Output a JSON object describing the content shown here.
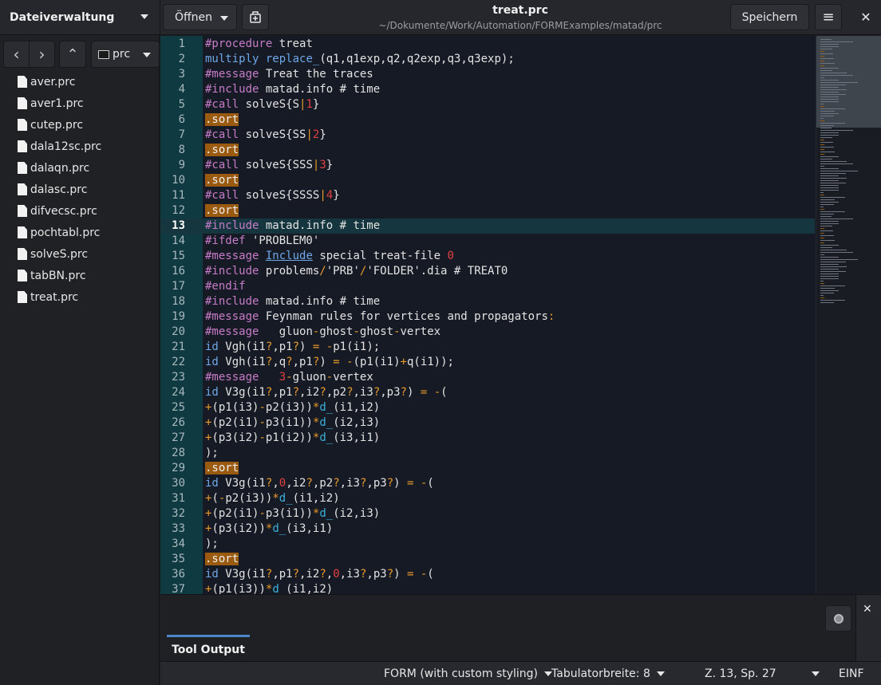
{
  "side_panel": {
    "title": "Dateiverwaltung"
  },
  "header": {
    "open_label": "Öffnen",
    "save_label": "Speichern",
    "title": "treat.prc",
    "path": "~/Dokumente/Work/Automation/FORMExamples/matad/prc",
    "close_glyph": "✕",
    "menu_glyph": "≡"
  },
  "file_browser": {
    "back_glyph": "‹",
    "forward_glyph": "›",
    "up_glyph": "⌃",
    "current_folder": "prc",
    "files": [
      "aver.prc",
      "aver1.prc",
      "cutep.prc",
      "dala12sc.prc",
      "dalaqn.prc",
      "dalasc.prc",
      "difvecsc.prc",
      "pochtabl.prc",
      "solveS.prc",
      "tabBN.prc",
      "treat.prc"
    ]
  },
  "editor": {
    "current_line": 13,
    "line_numbers": [
      "1",
      "2",
      "3",
      "4",
      "5",
      "6",
      "7",
      "8",
      "9",
      "10",
      "11",
      "12",
      "13",
      "14",
      "15",
      "16",
      "17",
      "18",
      "19",
      "20",
      "21",
      "22",
      "23",
      "24",
      "25",
      "26",
      "27",
      "28",
      "29",
      "30",
      "31",
      "32",
      "33",
      "34",
      "35",
      "36",
      "37"
    ],
    "lines": [
      [
        [
          "k",
          "#procedure"
        ],
        [
          "t",
          " treat"
        ]
      ],
      [
        [
          "b",
          "multiply"
        ],
        [
          "t",
          " "
        ],
        [
          "b",
          "replace_"
        ],
        [
          "t",
          "(q1,q1exp,q2,q2exp,q3,q3exp);"
        ]
      ],
      [
        [
          "k",
          "#message"
        ],
        [
          "t",
          " Treat the traces"
        ]
      ],
      [
        [
          "k",
          "#include"
        ],
        [
          "t",
          " matad.info # time"
        ]
      ],
      [
        [
          "k",
          "#call"
        ],
        [
          "t",
          " solveS{S"
        ],
        [
          "o",
          "|"
        ],
        [
          "r",
          "1"
        ],
        [
          "t",
          "}"
        ]
      ],
      [
        [
          "st",
          ".sort"
        ]
      ],
      [
        [
          "k",
          "#call"
        ],
        [
          "t",
          " solveS{SS"
        ],
        [
          "o",
          "|"
        ],
        [
          "r",
          "2"
        ],
        [
          "t",
          "}"
        ]
      ],
      [
        [
          "st",
          ".sort"
        ]
      ],
      [
        [
          "k",
          "#call"
        ],
        [
          "t",
          " solveS{SSS"
        ],
        [
          "o",
          "|"
        ],
        [
          "r",
          "3"
        ],
        [
          "t",
          "}"
        ]
      ],
      [
        [
          "st",
          ".sort"
        ]
      ],
      [
        [
          "k",
          "#call"
        ],
        [
          "t",
          " solveS{SSSS"
        ],
        [
          "o",
          "|"
        ],
        [
          "r",
          "4"
        ],
        [
          "t",
          "}"
        ]
      ],
      [
        [
          "st",
          ".sort"
        ]
      ],
      [
        [
          "k",
          "#include"
        ],
        [
          "t",
          " matad.info # time"
        ]
      ],
      [
        [
          "k",
          "#ifdef"
        ],
        [
          "t",
          " 'PROBLEM0'"
        ]
      ],
      [
        [
          "k",
          "#message"
        ],
        [
          "t",
          " "
        ],
        [
          "u",
          "Include"
        ],
        [
          "t",
          " special treat-file "
        ],
        [
          "r",
          "0"
        ]
      ],
      [
        [
          "k",
          "#include"
        ],
        [
          "t",
          " problems"
        ],
        [
          "o",
          "/"
        ],
        [
          "t",
          "'PRB'"
        ],
        [
          "o",
          "/"
        ],
        [
          "t",
          "'FOLDER'.dia # TREAT0"
        ]
      ],
      [
        [
          "k",
          "#endif"
        ]
      ],
      [
        [
          "k",
          "#include"
        ],
        [
          "t",
          " matad.info # time"
        ]
      ],
      [
        [
          "k",
          "#message"
        ],
        [
          "t",
          " Feynman rules for vertices and propagators"
        ],
        [
          "o",
          ":"
        ]
      ],
      [
        [
          "k",
          "#message"
        ],
        [
          "t",
          "   gluon"
        ],
        [
          "o",
          "-"
        ],
        [
          "t",
          "ghost"
        ],
        [
          "o",
          "-"
        ],
        [
          "t",
          "ghost"
        ],
        [
          "o",
          "-"
        ],
        [
          "t",
          "vertex"
        ]
      ],
      [
        [
          "b",
          "id"
        ],
        [
          "t",
          " Vgh(i1"
        ],
        [
          "o",
          "?"
        ],
        [
          "t",
          ",p1"
        ],
        [
          "o",
          "?"
        ],
        [
          "t",
          ") "
        ],
        [
          "o",
          "="
        ],
        [
          "t",
          " "
        ],
        [
          "o",
          "-"
        ],
        [
          "t",
          "p1(i1);"
        ]
      ],
      [
        [
          "b",
          "id"
        ],
        [
          "t",
          " Vgh(i1"
        ],
        [
          "o",
          "?"
        ],
        [
          "t",
          ",q"
        ],
        [
          "o",
          "?"
        ],
        [
          "t",
          ",p1"
        ],
        [
          "o",
          "?"
        ],
        [
          "t",
          ") "
        ],
        [
          "o",
          "="
        ],
        [
          "t",
          " "
        ],
        [
          "o",
          "-"
        ],
        [
          "t",
          "(p1(i1)"
        ],
        [
          "o",
          "+"
        ],
        [
          "t",
          "q(i1));"
        ]
      ],
      [
        [
          "k",
          "#message"
        ],
        [
          "t",
          "   "
        ],
        [
          "r",
          "3"
        ],
        [
          "o",
          "-"
        ],
        [
          "t",
          "gluon"
        ],
        [
          "o",
          "-"
        ],
        [
          "t",
          "vertex"
        ]
      ],
      [
        [
          "b",
          "id"
        ],
        [
          "t",
          " V3g(i1"
        ],
        [
          "o",
          "?"
        ],
        [
          "t",
          ",p1"
        ],
        [
          "o",
          "?"
        ],
        [
          "t",
          ",i2"
        ],
        [
          "o",
          "?"
        ],
        [
          "t",
          ",p2"
        ],
        [
          "o",
          "?"
        ],
        [
          "t",
          ",i3"
        ],
        [
          "o",
          "?"
        ],
        [
          "t",
          ",p3"
        ],
        [
          "o",
          "?"
        ],
        [
          "t",
          ") "
        ],
        [
          "o",
          "="
        ],
        [
          "t",
          " "
        ],
        [
          "o",
          "-"
        ],
        [
          "t",
          "("
        ]
      ],
      [
        [
          "o",
          "+"
        ],
        [
          "t",
          "(p1(i3)"
        ],
        [
          "o",
          "-"
        ],
        [
          "t",
          "p2(i3))"
        ],
        [
          "o",
          "*"
        ],
        [
          "c",
          "d_"
        ],
        [
          "t",
          "(i1,i2)"
        ]
      ],
      [
        [
          "o",
          "+"
        ],
        [
          "t",
          "(p2(i1)"
        ],
        [
          "o",
          "-"
        ],
        [
          "t",
          "p3(i1))"
        ],
        [
          "o",
          "*"
        ],
        [
          "c",
          "d_"
        ],
        [
          "t",
          "(i2,i3)"
        ]
      ],
      [
        [
          "o",
          "+"
        ],
        [
          "t",
          "(p3(i2)"
        ],
        [
          "o",
          "-"
        ],
        [
          "t",
          "p1(i2))"
        ],
        [
          "o",
          "*"
        ],
        [
          "c",
          "d_"
        ],
        [
          "t",
          "(i3,i1)"
        ]
      ],
      [
        [
          "t",
          ");"
        ]
      ],
      [
        [
          "st",
          ".sort"
        ]
      ],
      [
        [
          "b",
          "id"
        ],
        [
          "t",
          " V3g(i1"
        ],
        [
          "o",
          "?"
        ],
        [
          "t",
          ","
        ],
        [
          "r",
          "0"
        ],
        [
          "t",
          ",i2"
        ],
        [
          "o",
          "?"
        ],
        [
          "t",
          ",p2"
        ],
        [
          "o",
          "?"
        ],
        [
          "t",
          ",i3"
        ],
        [
          "o",
          "?"
        ],
        [
          "t",
          ",p3"
        ],
        [
          "o",
          "?"
        ],
        [
          "t",
          ") "
        ],
        [
          "o",
          "="
        ],
        [
          "t",
          " "
        ],
        [
          "o",
          "-"
        ],
        [
          "t",
          "("
        ]
      ],
      [
        [
          "o",
          "+"
        ],
        [
          "t",
          "("
        ],
        [
          "o",
          "-"
        ],
        [
          "t",
          "p2(i3))"
        ],
        [
          "o",
          "*"
        ],
        [
          "c",
          "d_"
        ],
        [
          "t",
          "(i1,i2)"
        ]
      ],
      [
        [
          "o",
          "+"
        ],
        [
          "t",
          "(p2(i1)"
        ],
        [
          "o",
          "-"
        ],
        [
          "t",
          "p3(i1))"
        ],
        [
          "o",
          "*"
        ],
        [
          "c",
          "d_"
        ],
        [
          "t",
          "(i2,i3)"
        ]
      ],
      [
        [
          "o",
          "+"
        ],
        [
          "t",
          "(p3(i2))"
        ],
        [
          "o",
          "*"
        ],
        [
          "c",
          "d_"
        ],
        [
          "t",
          "(i3,i1)"
        ]
      ],
      [
        [
          "t",
          ");"
        ]
      ],
      [
        [
          "st",
          ".sort"
        ]
      ],
      [
        [
          "b",
          "id"
        ],
        [
          "t",
          " V3g(i1"
        ],
        [
          "o",
          "?"
        ],
        [
          "t",
          ",p1"
        ],
        [
          "o",
          "?"
        ],
        [
          "t",
          ",i2"
        ],
        [
          "o",
          "?"
        ],
        [
          "t",
          ","
        ],
        [
          "r",
          "0"
        ],
        [
          "t",
          ",i3"
        ],
        [
          "o",
          "?"
        ],
        [
          "t",
          ",p3"
        ],
        [
          "o",
          "?"
        ],
        [
          "t",
          ") "
        ],
        [
          "o",
          "="
        ],
        [
          "t",
          " "
        ],
        [
          "o",
          "-"
        ],
        [
          "t",
          "("
        ]
      ],
      [
        [
          "o",
          "+"
        ],
        [
          "t",
          "(p1(i3))"
        ],
        [
          "o",
          "*"
        ],
        [
          "c",
          "d_"
        ],
        [
          "t",
          "(i1,i2)"
        ]
      ]
    ]
  },
  "bottom_panel": {
    "tab_label": "Tool Output",
    "close_glyph": "✕"
  },
  "status_bar": {
    "language": "FORM (with custom styling)",
    "tab_width": "Tabulatorbreite: 8",
    "position": "Z. 13, Sp. 27",
    "insert_mode": "EINF"
  }
}
